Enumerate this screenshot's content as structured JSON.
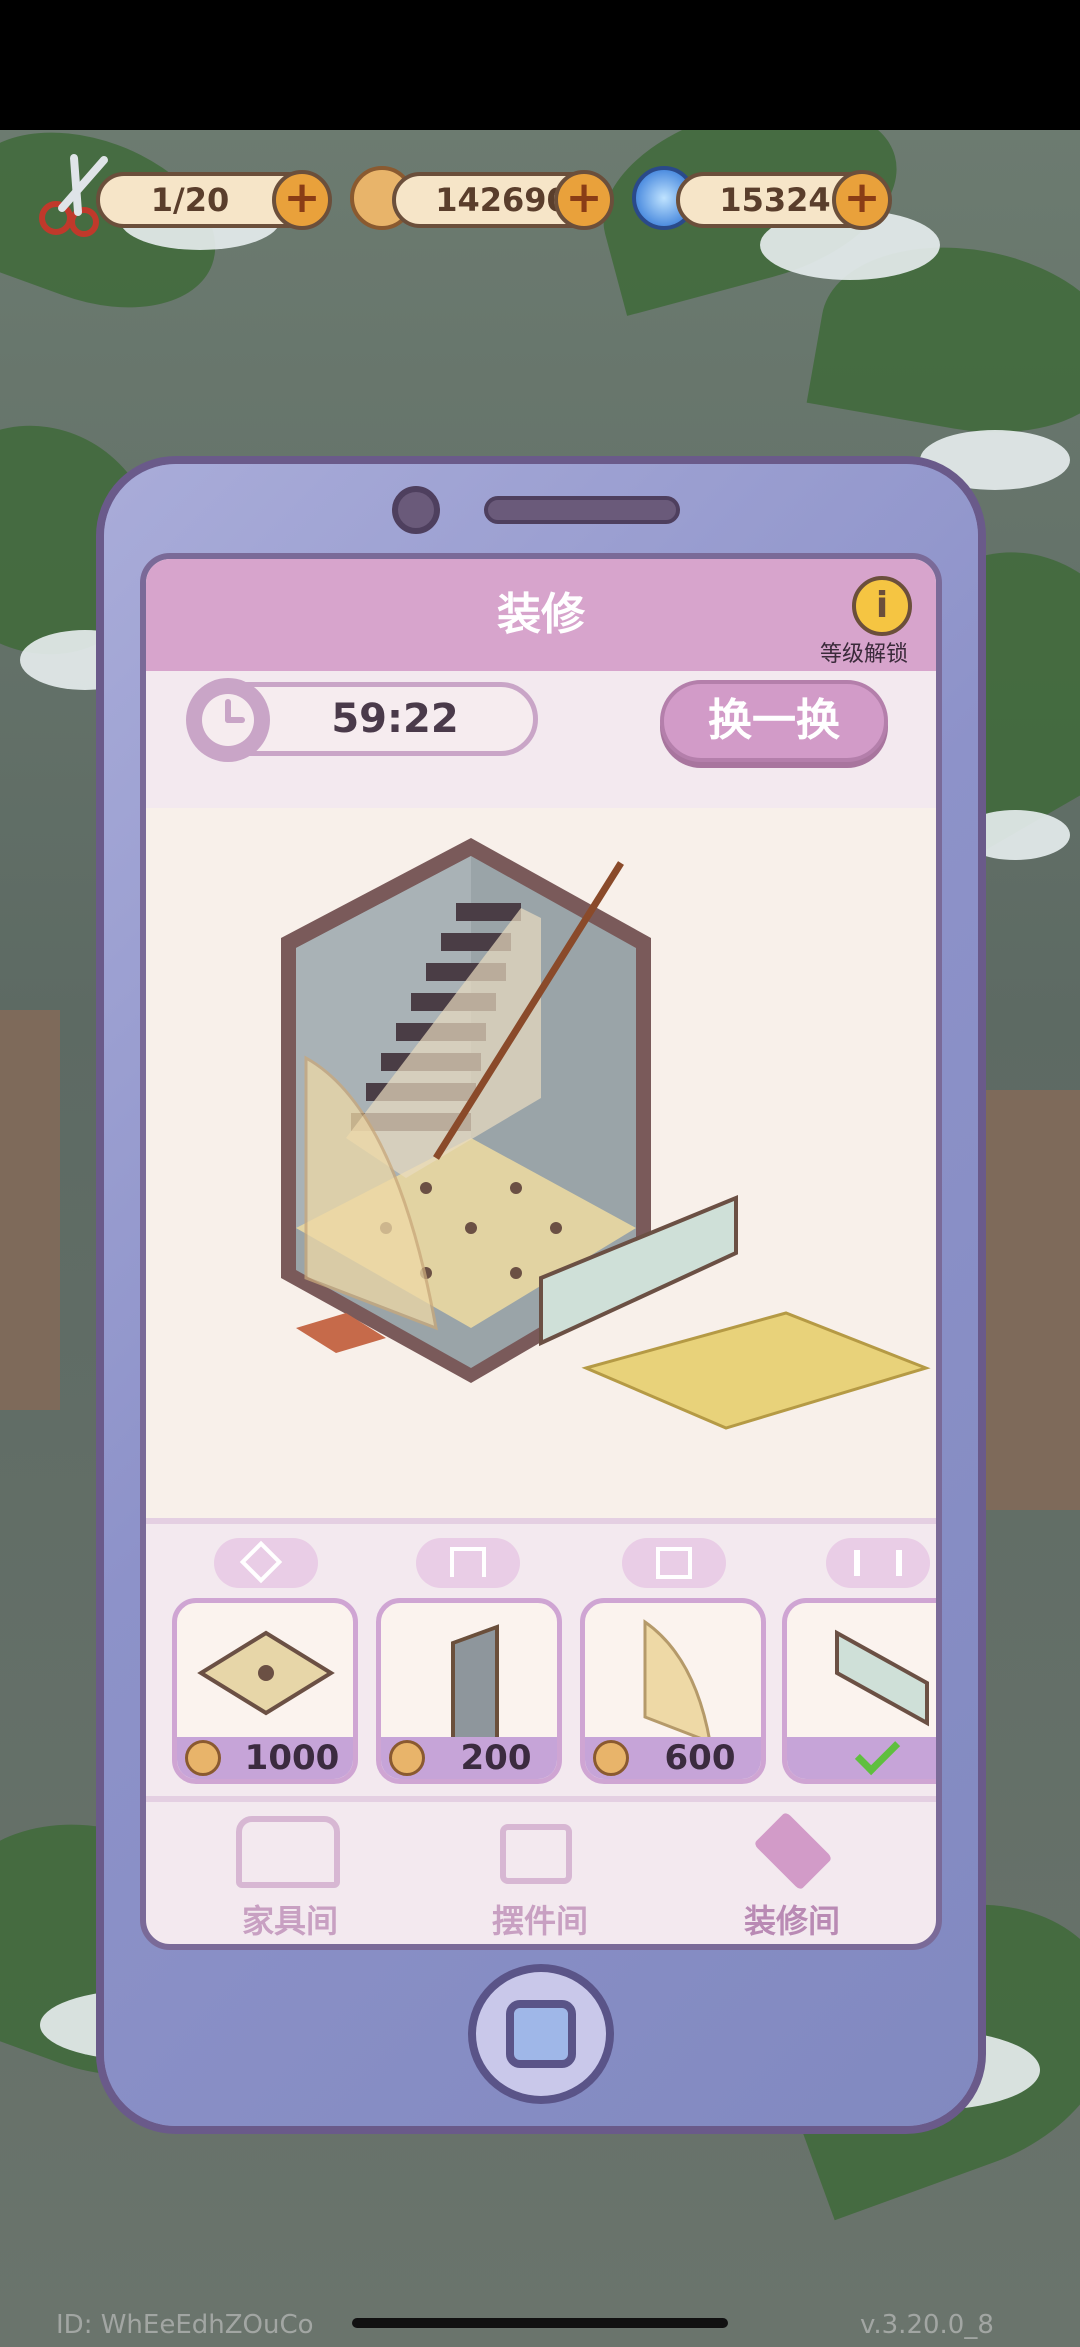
{
  "resources": {
    "scissors": "1/20",
    "coins": "142690",
    "gems": "15324"
  },
  "panel": {
    "title": "装修",
    "info_label": "等级解锁",
    "timer": "59:22",
    "refresh_label": "换一换"
  },
  "items": [
    {
      "name": "floor-tile",
      "price": "1000"
    },
    {
      "name": "wall-panel",
      "price": "200"
    },
    {
      "name": "glass-door",
      "price": "600"
    },
    {
      "name": "glass-railing",
      "price": "",
      "owned": true
    }
  ],
  "nav": [
    {
      "label": "家具间",
      "icon": "sofa-icon"
    },
    {
      "label": "摆件间",
      "icon": "cup-icon"
    },
    {
      "label": "装修间",
      "icon": "floor-tile-icon"
    }
  ],
  "footer": {
    "id_text": "ID: WhEeEdhZOuCo",
    "version": "v.3.20.0_8"
  },
  "colors": {
    "accent": "#c6a4d8",
    "frame": "#8b90c8",
    "header": "#d7a4cc"
  }
}
